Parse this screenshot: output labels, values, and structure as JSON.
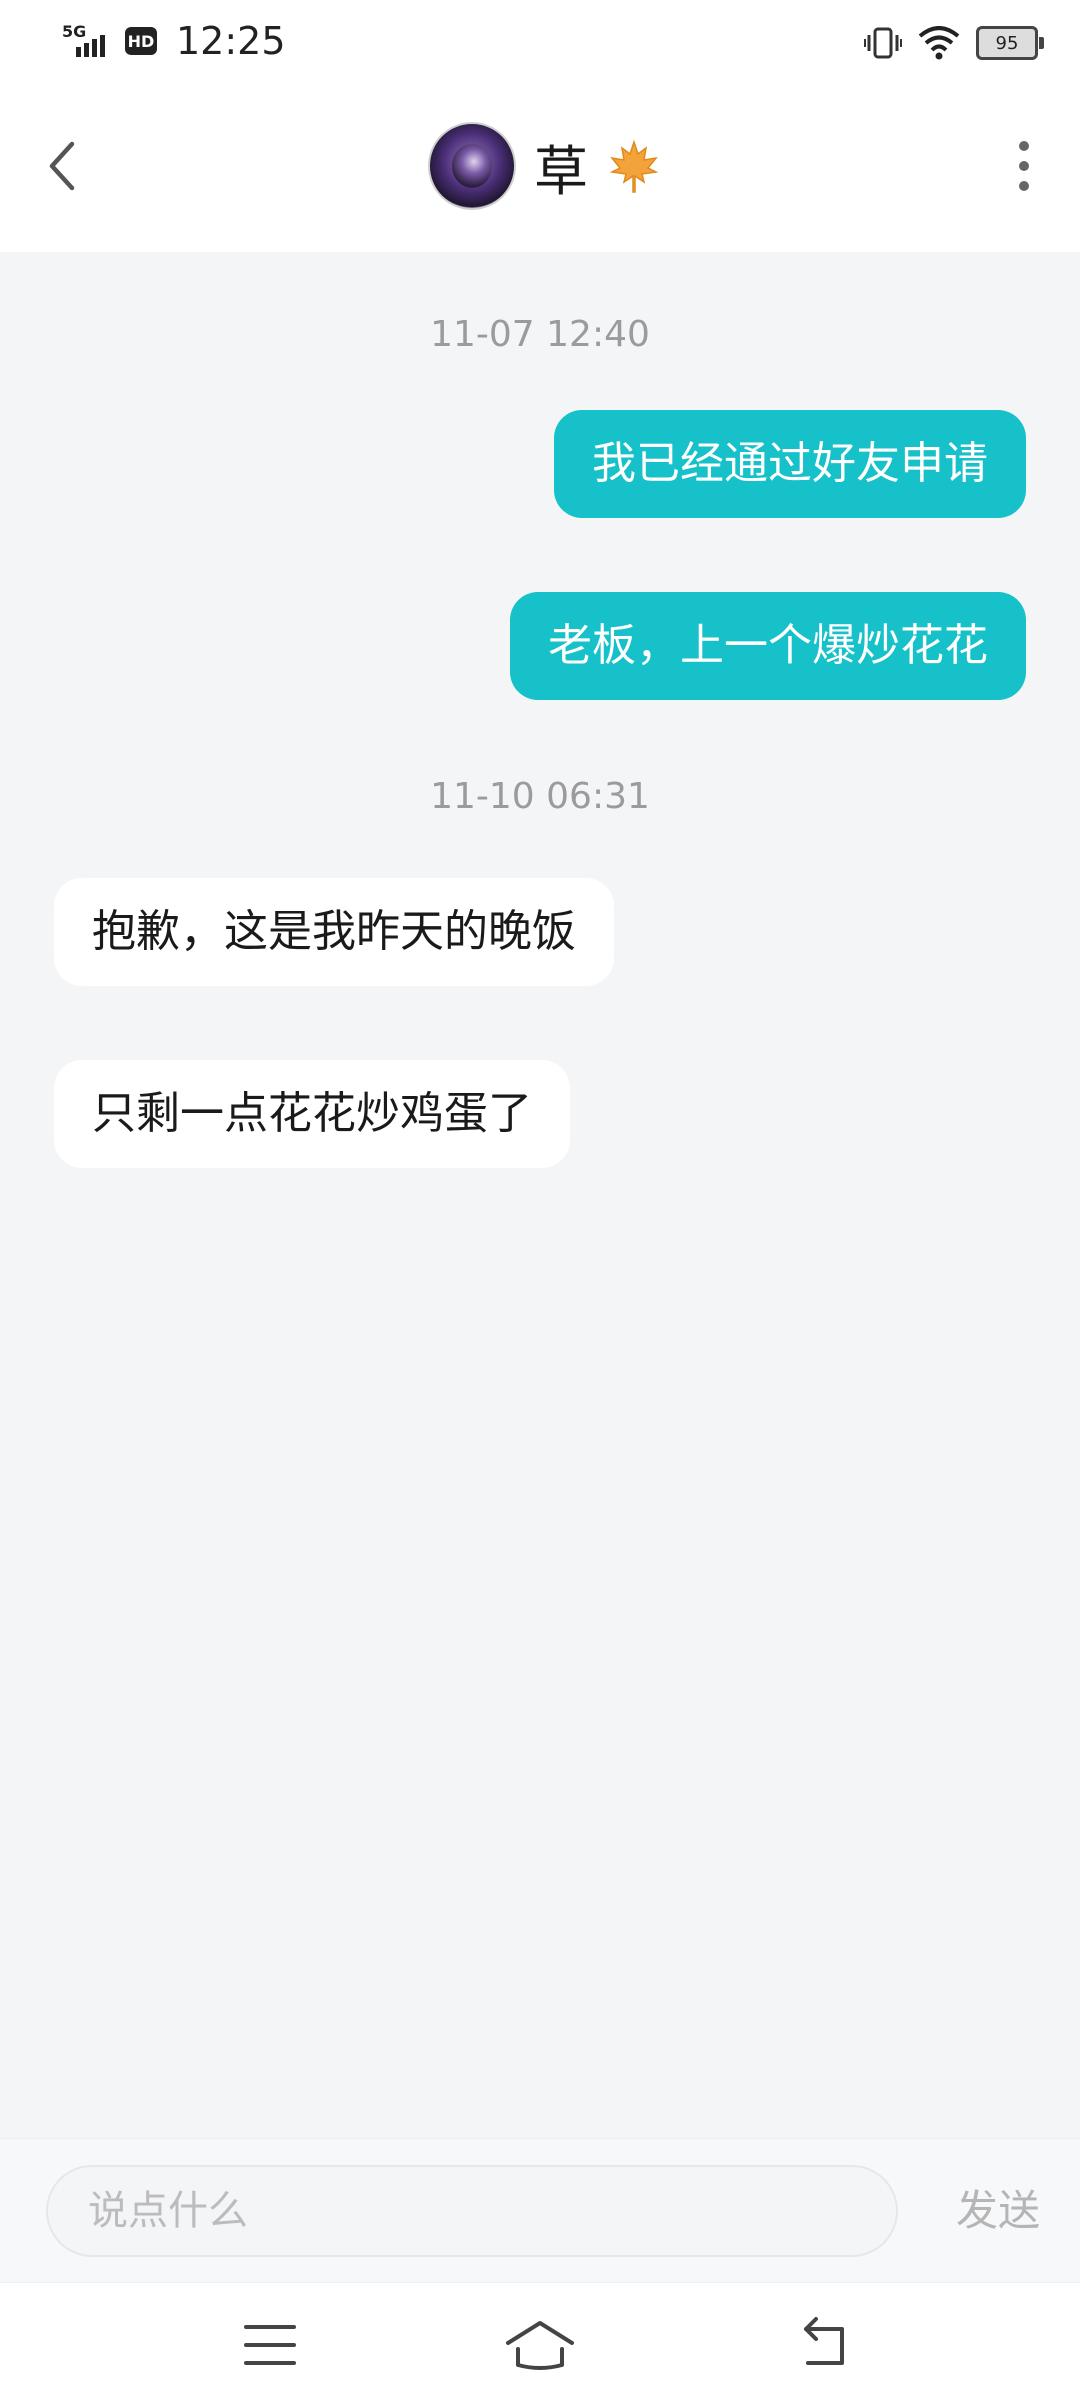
{
  "status_bar": {
    "network": "5G",
    "hd": "HD",
    "time": "12:25",
    "battery": "95",
    "icons": [
      "signal-icon",
      "hd-icon",
      "vibrate-icon",
      "wifi-icon",
      "battery-icon"
    ]
  },
  "header": {
    "title": "草",
    "title_icon": "maple-leaf-icon",
    "back_icon": "chevron-left-icon",
    "more_icon": "more-vertical-icon"
  },
  "messages": [
    {
      "type": "timestamp",
      "text": "11-07 12:40"
    },
    {
      "type": "sent",
      "text": "我已经通过好友申请"
    },
    {
      "type": "sent",
      "text": "老板，上一个爆炒花花"
    },
    {
      "type": "timestamp",
      "text": "11-10 06:31"
    },
    {
      "type": "received",
      "text": "抱歉，这是我昨天的晚饭"
    },
    {
      "type": "received",
      "text": "只剩一点花花炒鸡蛋了"
    }
  ],
  "input": {
    "placeholder": "说点什么",
    "value": "",
    "send_label": "发送"
  },
  "nav": {
    "icons": [
      "menu-icon",
      "home-icon",
      "back-icon"
    ]
  },
  "colors": {
    "accent": "#17c1c9",
    "background": "#f4f5f7",
    "timestamp": "#9b9b9b"
  }
}
